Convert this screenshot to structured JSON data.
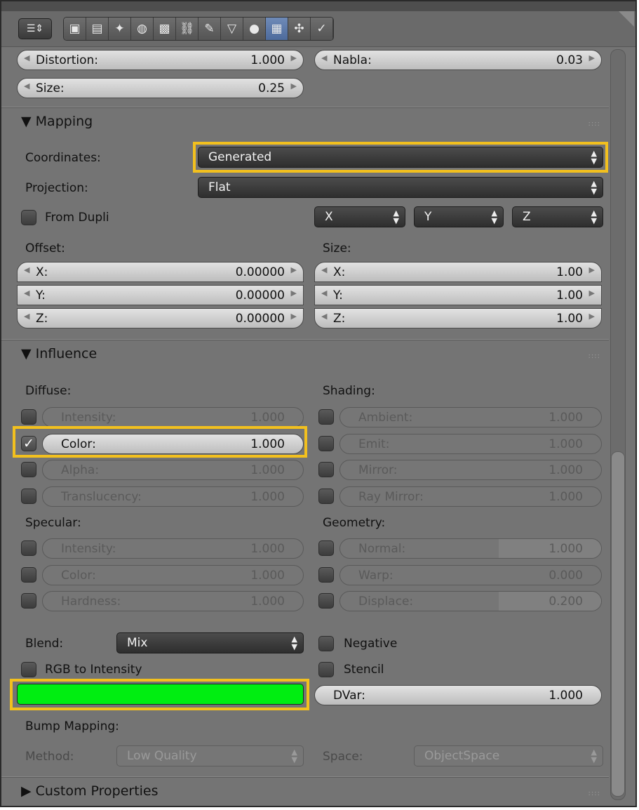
{
  "toolbar": {
    "editor_icon": "properties-editor-icon",
    "tabs": [
      {
        "icon": "render-icon",
        "glyph": "▣"
      },
      {
        "icon": "render-layers-icon",
        "glyph": "▤"
      },
      {
        "icon": "scene-icon",
        "glyph": "✦"
      },
      {
        "icon": "world-icon",
        "glyph": "◍"
      },
      {
        "icon": "object-icon",
        "glyph": "▩"
      },
      {
        "icon": "constraints-icon",
        "glyph": "⛓"
      },
      {
        "icon": "modifiers-icon",
        "glyph": "✎"
      },
      {
        "icon": "object-data-icon",
        "glyph": "▽"
      },
      {
        "icon": "material-icon",
        "glyph": "●"
      },
      {
        "icon": "texture-icon",
        "glyph": "▦"
      },
      {
        "icon": "particles-icon",
        "glyph": "✣"
      },
      {
        "icon": "physics-icon",
        "glyph": "✓"
      }
    ]
  },
  "noise": {
    "distortion_label": "Distortion:",
    "distortion_value": "1.000",
    "nabla_label": "Nabla:",
    "nabla_value": "0.03",
    "size_label": "Size:",
    "size_value": "0.25"
  },
  "mapping": {
    "title": "Mapping",
    "coordinates_label": "Coordinates:",
    "coordinates_value": "Generated",
    "projection_label": "Projection:",
    "projection_value": "Flat",
    "from_dupli_label": "From Dupli",
    "axis_x": "X",
    "axis_y": "Y",
    "axis_z": "Z",
    "offset_label": "Offset:",
    "size_label": "Size:",
    "offset": [
      {
        "label": "X:",
        "value": "0.00000"
      },
      {
        "label": "Y:",
        "value": "0.00000"
      },
      {
        "label": "Z:",
        "value": "0.00000"
      }
    ],
    "size": [
      {
        "label": "X:",
        "value": "1.00"
      },
      {
        "label": "Y:",
        "value": "1.00"
      },
      {
        "label": "Z:",
        "value": "1.00"
      }
    ]
  },
  "influence": {
    "title": "Influence",
    "diffuse_label": "Diffuse:",
    "shading_label": "Shading:",
    "specular_label": "Specular:",
    "geometry_label": "Geometry:",
    "diffuse": [
      {
        "label": "Intensity:",
        "value": "1.000",
        "checked": false
      },
      {
        "label": "Color:",
        "value": "1.000",
        "checked": true
      },
      {
        "label": "Alpha:",
        "value": "1.000",
        "checked": false
      },
      {
        "label": "Translucency:",
        "value": "1.000",
        "checked": false
      }
    ],
    "shading": [
      {
        "label": "Ambient:",
        "value": "1.000"
      },
      {
        "label": "Emit:",
        "value": "1.000"
      },
      {
        "label": "Mirror:",
        "value": "1.000"
      },
      {
        "label": "Ray Mirror:",
        "value": "1.000"
      }
    ],
    "specular": [
      {
        "label": "Intensity:",
        "value": "1.000"
      },
      {
        "label": "Color:",
        "value": "1.000"
      },
      {
        "label": "Hardness:",
        "value": "1.000"
      }
    ],
    "geometry": [
      {
        "label": "Normal:",
        "value": "1.000"
      },
      {
        "label": "Warp:",
        "value": "0.000"
      },
      {
        "label": "Displace:",
        "value": "0.200"
      }
    ],
    "blend_label": "Blend:",
    "blend_value": "Mix",
    "negative_label": "Negative",
    "rgb_to_intensity_label": "RGB to Intensity",
    "stencil_label": "Stencil",
    "color_swatch": "#00ee11",
    "dvar_label": "DVar:",
    "dvar_value": "1.000",
    "bump_label": "Bump Mapping:",
    "method_label": "Method:",
    "method_value": "Low Quality",
    "space_label": "Space:",
    "space_value": "ObjectSpace"
  },
  "custom_properties": {
    "title": "Custom Properties"
  },
  "highlight_color": "#f2c01e"
}
